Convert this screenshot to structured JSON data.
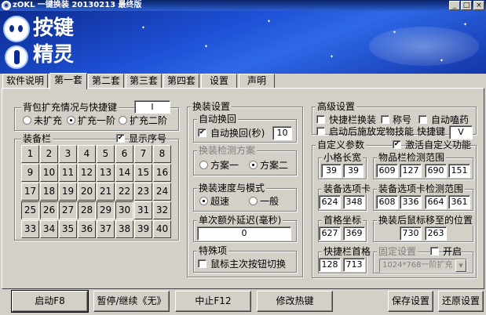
{
  "window": {
    "title": "zOKL 一键换装 20130213 最终版",
    "min": "_",
    "max": "□",
    "close": "×"
  },
  "logo": {
    "line1": "按键",
    "line2": "精灵"
  },
  "tabs": [
    "软件说明",
    "第一套",
    "第二套",
    "第三套",
    "第四套",
    "设置",
    "声明"
  ],
  "active_tab": 1,
  "backpack": {
    "title": "背包扩充情况与快捷键",
    "hotkey": "I",
    "options": [
      "未扩充",
      "扩充一阶",
      "扩充二阶"
    ],
    "selected": 1
  },
  "equipbar": {
    "title": "装备栏",
    "show_index_label": "显示序号",
    "cells": [
      "1",
      "2",
      "3",
      "4",
      "5",
      "6",
      "7",
      "8",
      "9",
      "10",
      "11",
      "12",
      "13",
      "14",
      "15",
      "16",
      "17",
      "18",
      "19",
      "20",
      "21",
      "22",
      "23",
      "24",
      "25",
      "26",
      "27",
      "28",
      "29",
      "30",
      "31",
      "32",
      "33",
      "34",
      "35",
      "36",
      "37",
      "38",
      "39",
      "40"
    ]
  },
  "swap": {
    "title": "换装设置",
    "auto_title": "自动换回",
    "auto_label": "自动换回(秒)",
    "auto_value": "10",
    "detect_title": "换装检测方案",
    "detect_options": [
      "方案一",
      "方案二"
    ],
    "detect_selected": 1,
    "speed_title": "换装速度与模式",
    "speed_options": [
      "超速",
      "一般"
    ],
    "speed_selected": 0,
    "delay_title": "单次额外延迟(毫秒)",
    "delay_value": "0",
    "special_title": "特殊项",
    "special_label": "鼠标主次按钮切换"
  },
  "advanced": {
    "title": "高级设置",
    "opt1": "快捷栏换装",
    "opt2": "称号",
    "opt3": "自动嗑药",
    "opt4": "启动后施放宠物技能",
    "hotkey_label": "快捷键",
    "hotkey_value": "V"
  },
  "custom": {
    "title": "自定义参数",
    "activate_label": "激活自定义功能",
    "cell_size": {
      "title": "小格长宽",
      "values": [
        "39",
        "39"
      ]
    },
    "item_range": {
      "title": "物品栏检测范围",
      "values": [
        "609",
        "127",
        "690",
        "151"
      ]
    },
    "equip_tab": {
      "title": "装备选项卡",
      "values": [
        "624",
        "348"
      ]
    },
    "equip_tab_range": {
      "title": "装备选项卡检测范围",
      "values": [
        "608",
        "336",
        "664",
        "361"
      ]
    },
    "first_coord": {
      "title": "首格坐标",
      "values": [
        "627",
        "369"
      ]
    },
    "mouse_pos": {
      "title": "换装后鼠标移至的位置",
      "values": [
        "730",
        "263"
      ]
    },
    "quickbar_first": {
      "title": "快捷栏首格",
      "values": [
        "128",
        "713"
      ]
    },
    "fixed": {
      "title": "固定设置",
      "enable_label": "开启",
      "select_value": "1024*768一阶扩充"
    }
  },
  "buttons": {
    "start": "启动F8",
    "pause": "暂停/继续《无》",
    "stop": "中止F12",
    "edit_hotkey": "修改热键",
    "save": "保存设置",
    "restore": "还原设置"
  }
}
